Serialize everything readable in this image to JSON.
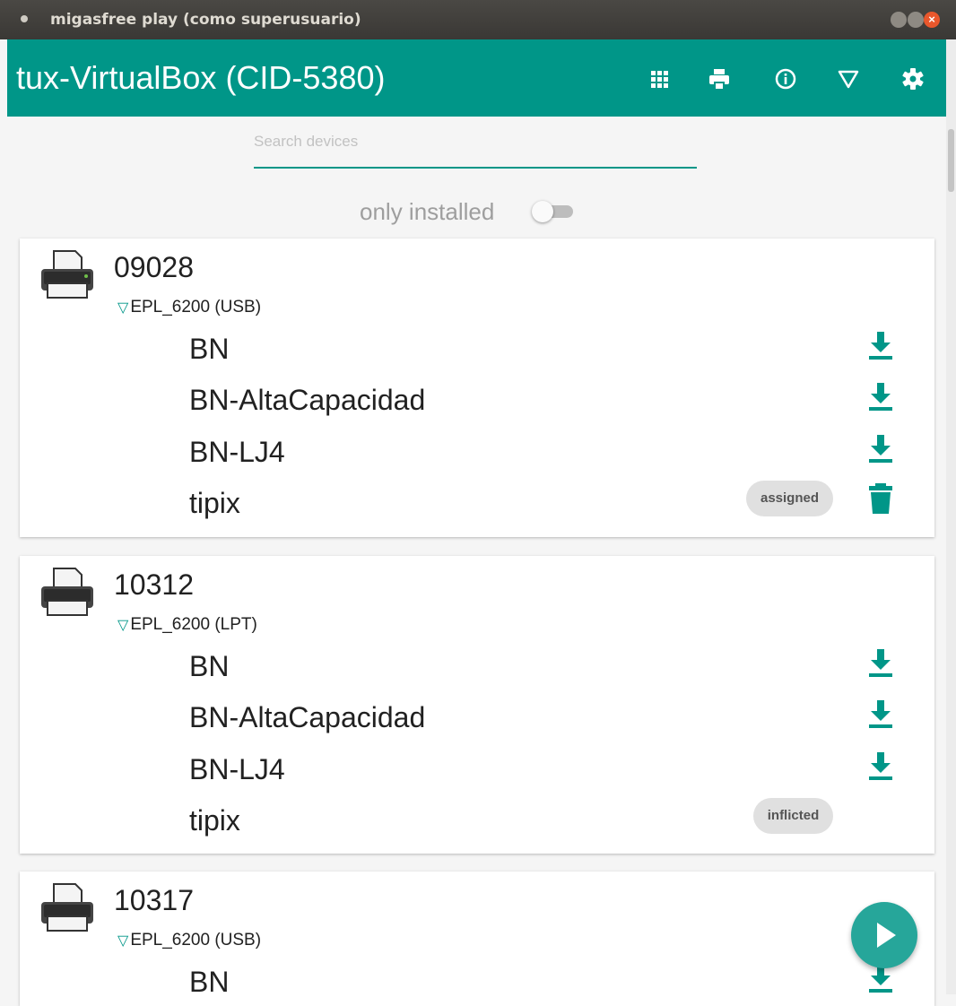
{
  "window": {
    "title": "migasfree play (como superusuario)"
  },
  "header": {
    "hostname": "tux-VirtualBox (CID-5380)",
    "icons": [
      "apps-icon",
      "print-icon",
      "info-icon",
      "filter-icon",
      "settings-icon"
    ]
  },
  "search": {
    "placeholder": "Search devices",
    "value": ""
  },
  "filter": {
    "only_installed_label": "only installed",
    "only_installed_on": false
  },
  "devices": [
    {
      "name": "09028",
      "model": "EPL_6200 (USB)",
      "drivers": [
        {
          "label": "BN",
          "action": "download-icon"
        },
        {
          "label": "BN-AltaCapacidad",
          "action": "download-icon"
        },
        {
          "label": "BN-LJ4",
          "action": "download-icon"
        },
        {
          "label": "tipix",
          "badge": "assigned",
          "action": "trash-icon"
        }
      ]
    },
    {
      "name": "10312",
      "model": "EPL_6200 (LPT)",
      "drivers": [
        {
          "label": "BN",
          "action": "download-icon"
        },
        {
          "label": "BN-AltaCapacidad",
          "action": "download-icon"
        },
        {
          "label": "BN-LJ4",
          "action": "download-icon"
        },
        {
          "label": "tipix",
          "badge": "inflicted"
        }
      ]
    },
    {
      "name": "10317",
      "model": "EPL_6200 (USB)",
      "drivers": [
        {
          "label": "BN",
          "action": "download-icon"
        }
      ]
    }
  ],
  "colors": {
    "primary": "#009688",
    "fab": "#26a69a"
  }
}
